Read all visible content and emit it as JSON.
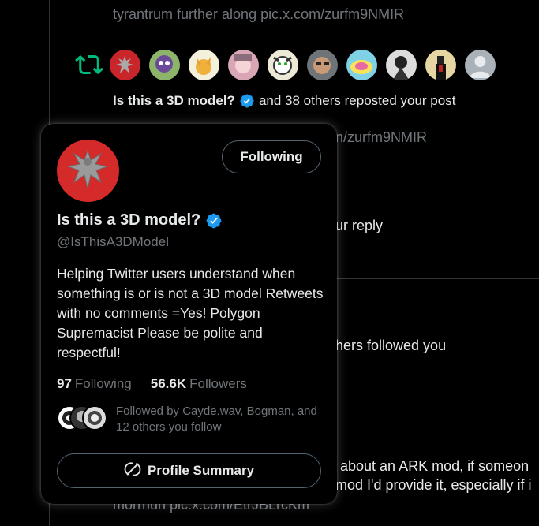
{
  "feed": {
    "top_link_text": "tyrantrum further along pic.x.com/zurfm9NMIR",
    "repost_notification": {
      "name": "Is this a 3D model?",
      "suffix": "and 38 others reposted your post"
    },
    "partial_link_text": "n/zurfm9NMIR",
    "partial_reply_text": "ur reply",
    "partial_followed_text": "hers followed you",
    "partial_post_line1": "about an ARK mod, if someon",
    "partial_post_line2": "mod I'd provide it, especially if i",
    "partial_post_line3": "morrhun pic.x.com/EtrJBLrcKm"
  },
  "hovercard": {
    "follow_button_label": "Following",
    "display_name": "Is this a 3D model?",
    "handle": "@IsThisA3DModel",
    "bio": "Helping Twitter users understand when something is or is not a 3D model Retweets with no comments =Yes! Polygon Supremacist Please be polite and respectful!",
    "following_count": "97",
    "following_label": "Following",
    "followers_count": "56.6K",
    "followers_label": "Followers",
    "followed_by_text": "Followed by Cayde.wav, Bogman, and 12 others you follow",
    "profile_summary_label": "Profile Summary"
  },
  "colors": {
    "background": "#000000",
    "verified_blue": "#1d9bf0",
    "repost_green": "#00ba7c",
    "muted_text": "#71767b",
    "avatar_red": "#d42a2a"
  }
}
